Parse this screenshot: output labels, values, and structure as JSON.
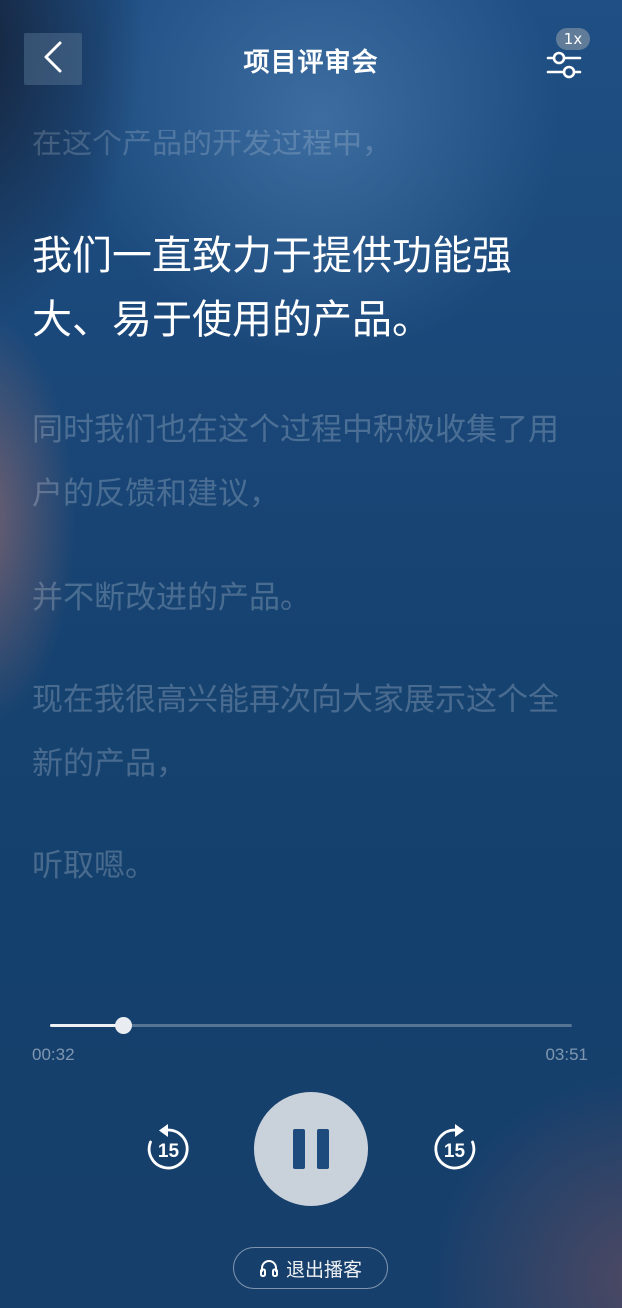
{
  "header": {
    "title": "项目评审会",
    "back_icon": "chevron-left-icon",
    "settings_icon": "sliders-icon",
    "speed_label": "1x"
  },
  "transcript": {
    "previous_line": "在这个产品的开发过程中，",
    "current_line": "我们一直致力于提供功能强大、易于使用的产品。",
    "next_lines": [
      "同时我们也在这个过程中积极收集了用户的反馈和建议，",
      "并不断改进的产品。",
      "现在我很高兴能再次向大家展示这个全新的产品，",
      "听取嗯。"
    ]
  },
  "player": {
    "elapsed": "00:32",
    "total": "03:51",
    "progress": 0.139,
    "rewind_label": "15",
    "forward_label": "15",
    "state": "playing"
  },
  "footer": {
    "exit_label": "退出播客",
    "exit_icon": "headphones-icon"
  },
  "colors": {
    "background": "#15406f",
    "active_text": "#ffffff",
    "pause_button": "#c9d1db"
  }
}
